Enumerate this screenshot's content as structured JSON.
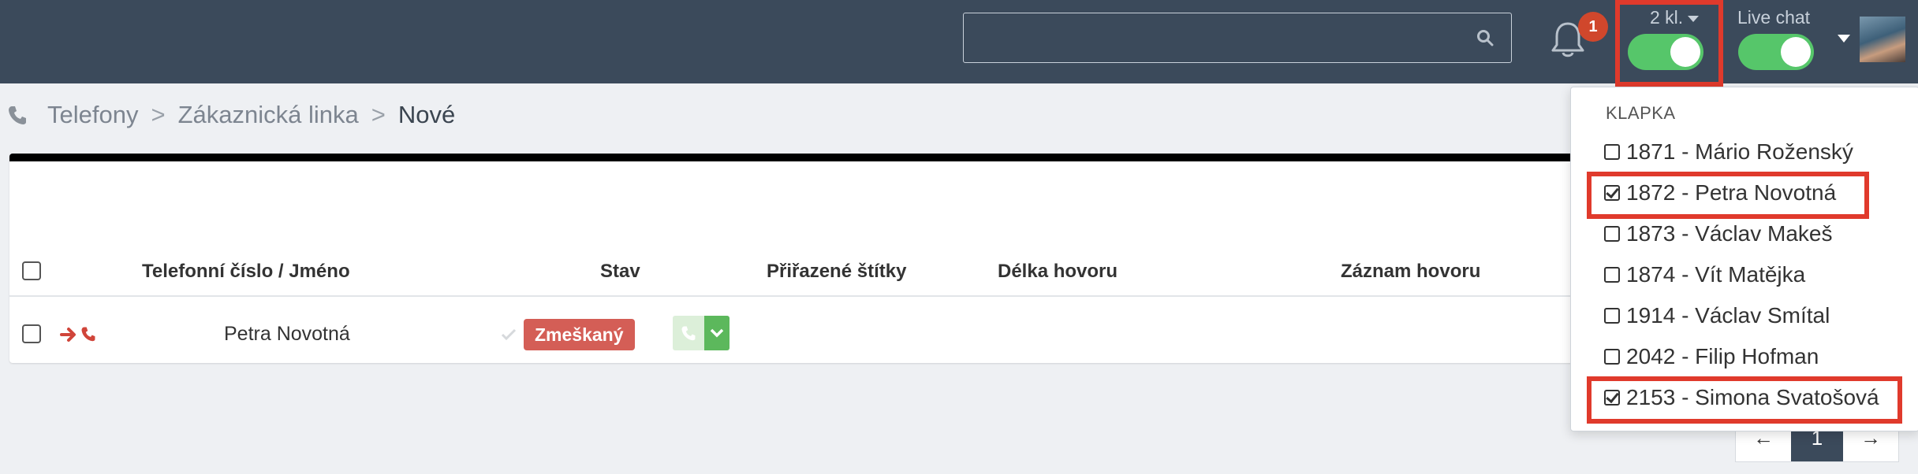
{
  "header": {
    "search": {
      "placeholder": "",
      "value": ""
    },
    "notifications": {
      "count": "1"
    },
    "extensions_toggle": {
      "label": "2 kl.",
      "on": true
    },
    "live_chat_toggle": {
      "label": "Live chat",
      "on": true
    },
    "colors": {
      "bar": "#3b4a5b",
      "toggle_on": "#56c66a",
      "badge": "#d0472c",
      "highlight": "#e03a2c"
    }
  },
  "breadcrumb": {
    "items": [
      "Telefony",
      "Zákaznická linka",
      "Nové"
    ],
    "separator": ">"
  },
  "table": {
    "columns": [
      "Telefonní číslo / Jméno",
      "Stav",
      "Přiřazené štítky",
      "Délka hovoru",
      "Záznam hovoru"
    ],
    "rows": [
      {
        "name": "Petra Novotná",
        "status": "Zmeškaný",
        "direction": "incoming-call",
        "tags": "",
        "duration": "",
        "recording": ""
      }
    ]
  },
  "pagination": {
    "prev": "←",
    "current": "1",
    "next": "→"
  },
  "extension_dropdown": {
    "header": "KLAPKA",
    "items": [
      {
        "label": "1871 - Mário Roženský",
        "checked": false
      },
      {
        "label": "1872 - Petra Novotná",
        "checked": true
      },
      {
        "label": "1873 - Václav Makeš",
        "checked": false
      },
      {
        "label": "1874 - Vít Matějka",
        "checked": false
      },
      {
        "label": "1914 - Václav Smítal",
        "checked": false
      },
      {
        "label": "2042 - Filip Hofman",
        "checked": false
      },
      {
        "label": "2153 - Simona Svatošová",
        "checked": true
      }
    ]
  }
}
